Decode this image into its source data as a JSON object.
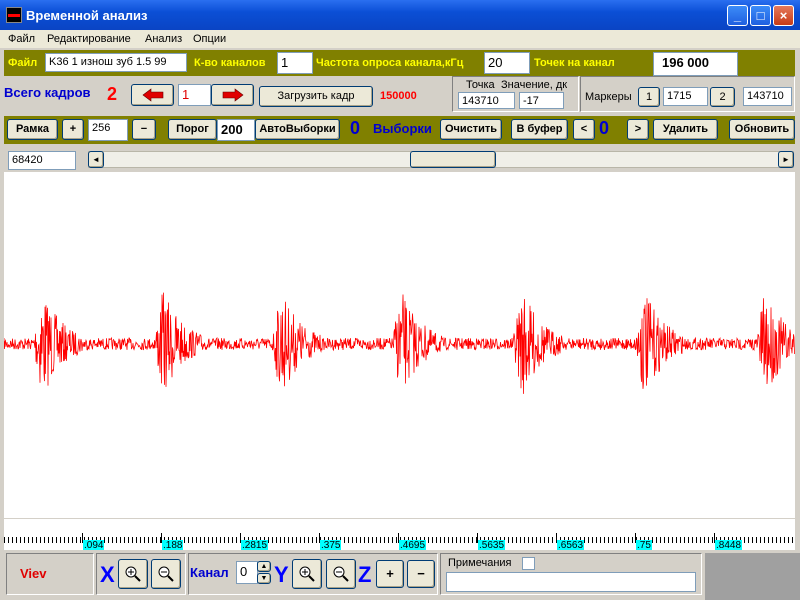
{
  "window": {
    "title": "Временной анализ"
  },
  "menu": [
    "Файл",
    "Редактирование",
    "Анализ",
    "Опции"
  ],
  "row1": {
    "file_label": "Файл",
    "file_value": "K36  1 изнош зуб 1.5  99",
    "channels_label": "К-во каналов",
    "channels_value": "1",
    "freq_label": "Частота опроса канала,кГц",
    "freq_value": "20",
    "points_label": "Точек на канал",
    "points_value": "196 000"
  },
  "row2": {
    "total_frames_label": "Всего кадров",
    "total_frames_value": "2",
    "frame_value": "1",
    "load_button": "Загрузить кадр",
    "load_count": "150000",
    "point_label": "Точка",
    "value_label": "Значение, дк",
    "point_value": "143710",
    "value_value": "-17",
    "markers_label": "Маркеры",
    "marker1_button": "1",
    "marker1_value": "1715",
    "marker2_button": "2",
    "marker2_value": "143710"
  },
  "row3": {
    "frame_button": "Рамка",
    "plus_button": "+",
    "frame_value": "256",
    "minus_button": "−",
    "threshold_button": "Порог",
    "threshold_value": "200",
    "auto_button": "АвтоВыборки",
    "count_value": "0",
    "samples_label": "Выборки",
    "clear_button": "Очистить",
    "tobuffer_button": "В буфер",
    "prev_button": "<",
    "buffer_count": "0",
    "next_button": ">",
    "delete_button": "Удалить",
    "refresh_button": "Обновить"
  },
  "scroll": {
    "position_value": "68420",
    "left_arrow": "◄",
    "right_arrow": "►"
  },
  "ruler_labels": [
    ".094",
    ".188",
    ".2815",
    ".375",
    ".4695",
    ".5635",
    ".6563",
    ".75",
    ".8448"
  ],
  "bottom": {
    "view_label": "Viev",
    "x_label": "X",
    "channel_label": "Канал",
    "channel_value": "0",
    "y_label": "Y",
    "z_label": "Z",
    "z_plus": "+",
    "z_minus": "−",
    "notes_label": "Примечания"
  },
  "colors": {
    "signal": "#ff0000",
    "olive": "#808000",
    "label_yellow": "#ffff00",
    "ruler_label_bg": "#00ffff"
  }
}
